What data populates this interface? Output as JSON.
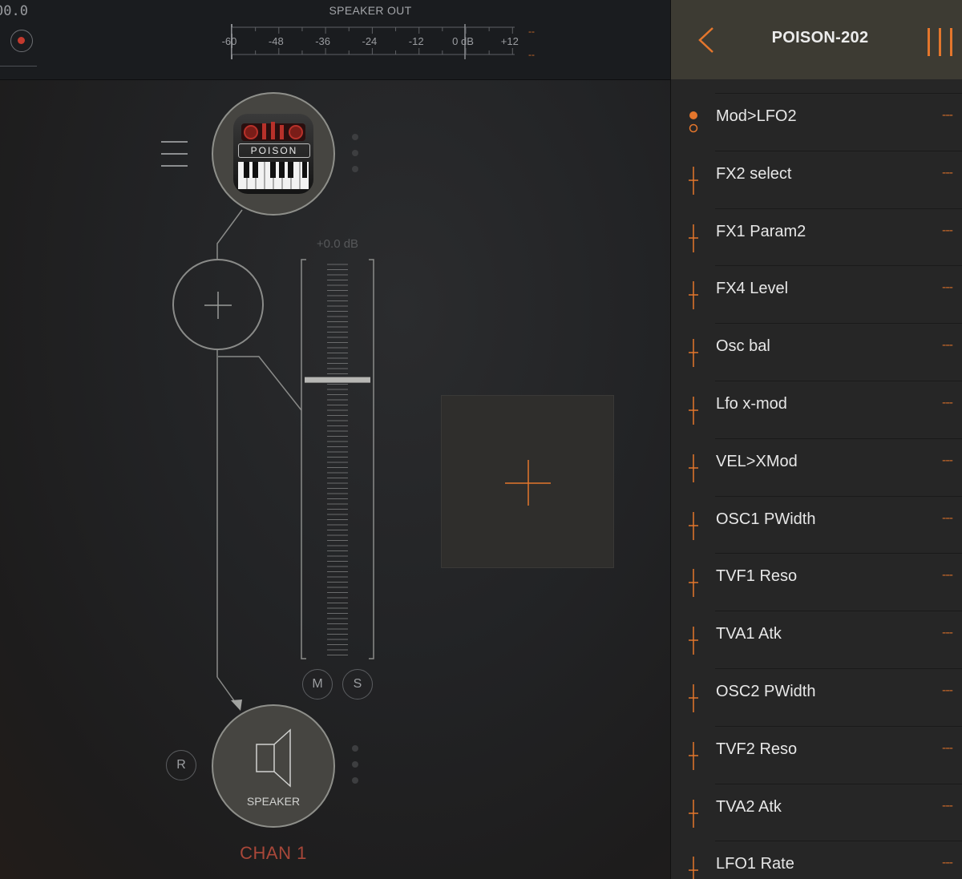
{
  "transport": {
    "time": "00.0"
  },
  "meter": {
    "title": "SPEAKER OUT",
    "scale": [
      "-60",
      "-48",
      "-36",
      "-24",
      "-12",
      "0 dB",
      "+12"
    ],
    "overload_left": "--",
    "overload_right": "--"
  },
  "channel": {
    "synth_logo": "POISON",
    "gain": "+0.0 dB",
    "mute_label": "M",
    "solo_label": "S",
    "record_label": "R",
    "output_label": "SPEAKER",
    "name": "CHAN 1",
    "fader_level_percent": 70
  },
  "panel": {
    "title": "POISON-202",
    "parameters": [
      {
        "name": "Mod>LFO2",
        "value": "---",
        "selected": true
      },
      {
        "name": "FX2 select",
        "value": "---"
      },
      {
        "name": "FX1 Param2",
        "value": "---"
      },
      {
        "name": "FX4 Level",
        "value": "---"
      },
      {
        "name": "Osc bal",
        "value": "---"
      },
      {
        "name": "Lfo x-mod",
        "value": "---"
      },
      {
        "name": "VEL>XMod",
        "value": "---"
      },
      {
        "name": "OSC1 PWidth",
        "value": "---"
      },
      {
        "name": "TVF1 Reso",
        "value": "---"
      },
      {
        "name": "TVA1 Atk",
        "value": "---"
      },
      {
        "name": "OSC2 PWidth",
        "value": "---"
      },
      {
        "name": "TVF2 Reso",
        "value": "---"
      },
      {
        "name": "TVA2 Atk",
        "value": "---"
      },
      {
        "name": "LFO1 Rate",
        "value": "---"
      }
    ]
  },
  "colors": {
    "accent": "#e4762c",
    "record": "#c43a2e",
    "channel_name": "#a84739"
  }
}
